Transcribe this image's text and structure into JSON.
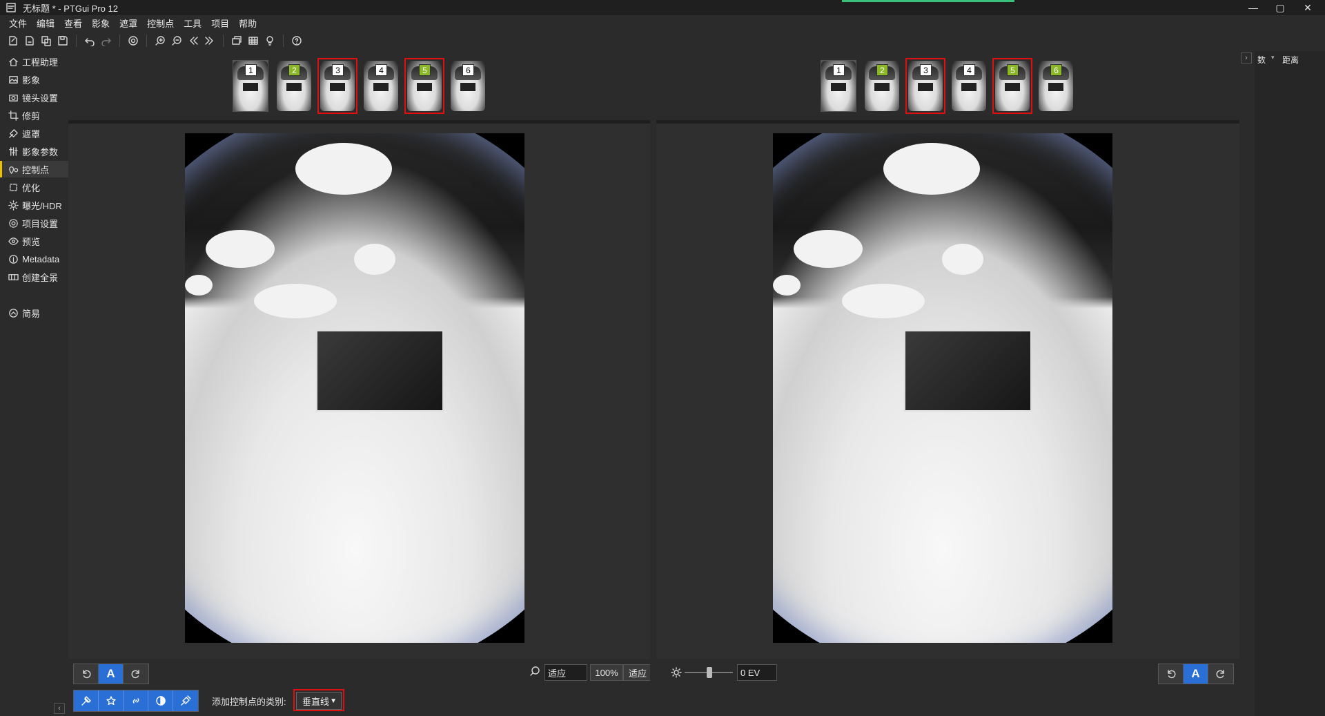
{
  "window": {
    "title": "无标题 * - PTGui Pro 12"
  },
  "menu": [
    "文件",
    "编辑",
    "查看",
    "影象",
    "遮罩",
    "控制点",
    "工具",
    "项目",
    "帮助"
  ],
  "sidebar": {
    "items": [
      {
        "label": "工程助理",
        "icon": "home-icon"
      },
      {
        "label": "影象",
        "icon": "image-icon"
      },
      {
        "label": "镜头设置",
        "icon": "camera-icon"
      },
      {
        "label": "修剪",
        "icon": "crop-icon"
      },
      {
        "label": "遮罩",
        "icon": "mask-icon"
      },
      {
        "label": "影象参数",
        "icon": "sliders-icon"
      },
      {
        "label": "控制点",
        "icon": "control-points-icon"
      },
      {
        "label": "优化",
        "icon": "optimize-icon"
      },
      {
        "label": "曝光/HDR",
        "icon": "sun-icon"
      },
      {
        "label": "项目设置",
        "icon": "gear-icon"
      },
      {
        "label": "预览",
        "icon": "eye-icon"
      },
      {
        "label": "Metadata",
        "icon": "info-icon"
      },
      {
        "label": "创建全景",
        "icon": "panorama-icon"
      }
    ],
    "active_index": 6,
    "simple_label": "简易"
  },
  "left_pane": {
    "thumbs": [
      "1",
      "2",
      "3",
      "4",
      "5",
      "6"
    ],
    "current": 0,
    "green": [
      1,
      4
    ],
    "highlighted": [
      2,
      4
    ]
  },
  "right_pane": {
    "thumbs": [
      "1",
      "2",
      "3",
      "4",
      "5",
      "6"
    ],
    "current": 0,
    "green": [
      1,
      4,
      5
    ],
    "highlighted": [
      2,
      4
    ]
  },
  "bottom": {
    "auto_label": "A",
    "cp_type_label": "添加控制点的类别:",
    "cp_type_value": "垂直线",
    "zoom_fit_value": "适应",
    "zoom_100": "100%",
    "zoom_fit_button": "适应",
    "ev_value": "0 EV",
    "right_auto_label": "A"
  },
  "rightdock": {
    "col1": "数",
    "col2": "距离"
  }
}
